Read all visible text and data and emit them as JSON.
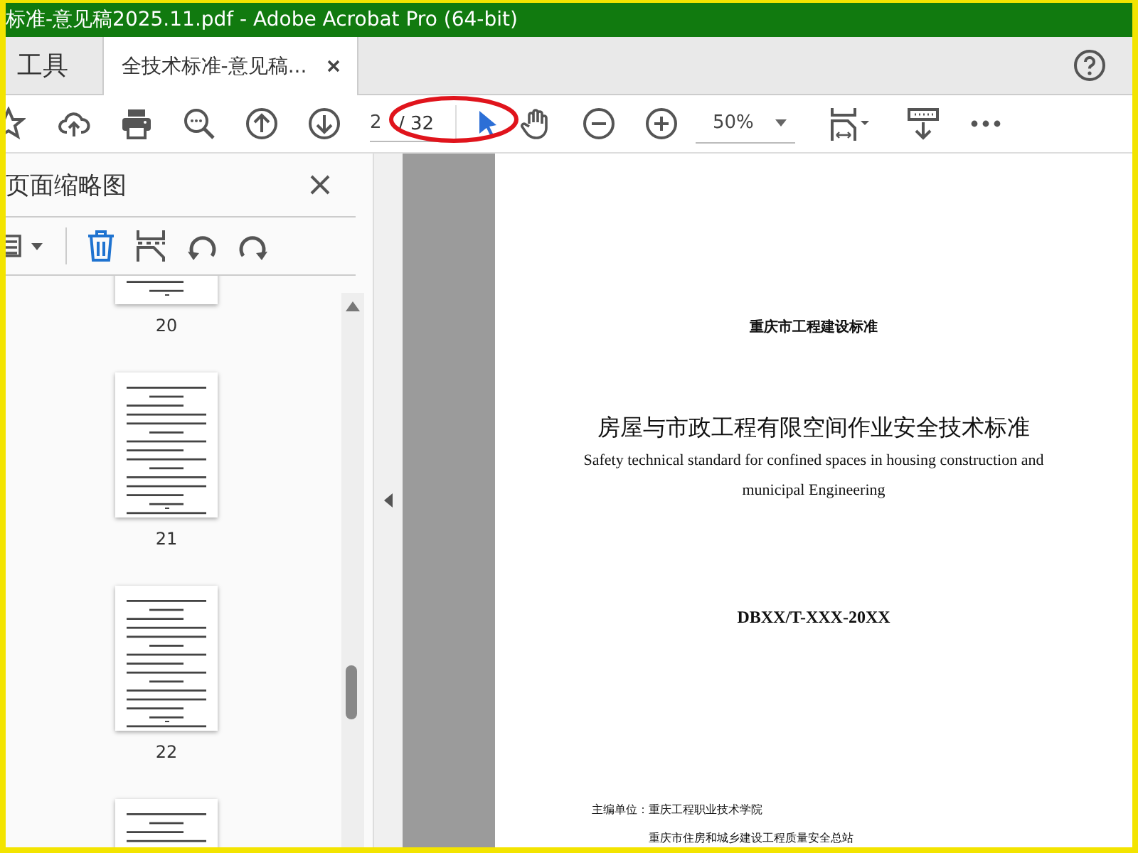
{
  "window": {
    "title": "标准-意见稿2025.11.pdf - Adobe Acrobat Pro (64-bit)"
  },
  "tabs": [
    {
      "label": "工具",
      "kind": "tools",
      "selected": false
    },
    {
      "label": "全技术标准-意见稿...",
      "kind": "document",
      "selected": true
    }
  ],
  "toolbar": {
    "page_field": {
      "value": "2"
    },
    "page_total": "/ 32",
    "zoom": {
      "value": "50%"
    }
  },
  "thumbnail_panel": {
    "title": "页面缩略图",
    "pages": [
      {
        "label": "20"
      },
      {
        "label": "21"
      },
      {
        "label": "22"
      }
    ]
  },
  "document": {
    "header": "重庆市工程建设标准",
    "title": "房屋与市政工程有限空间作业安全技术标准",
    "subtitle_lines": [
      "Safety technical standard for confined spaces in housing construction and",
      "municipal Engineering"
    ],
    "code": "DBXX/T-XXX-20XX",
    "editors_label": "主编单位：",
    "editors": [
      "重庆工程职业技术学院",
      "重庆市住房和城乡建设工程质量安全总站"
    ]
  }
}
